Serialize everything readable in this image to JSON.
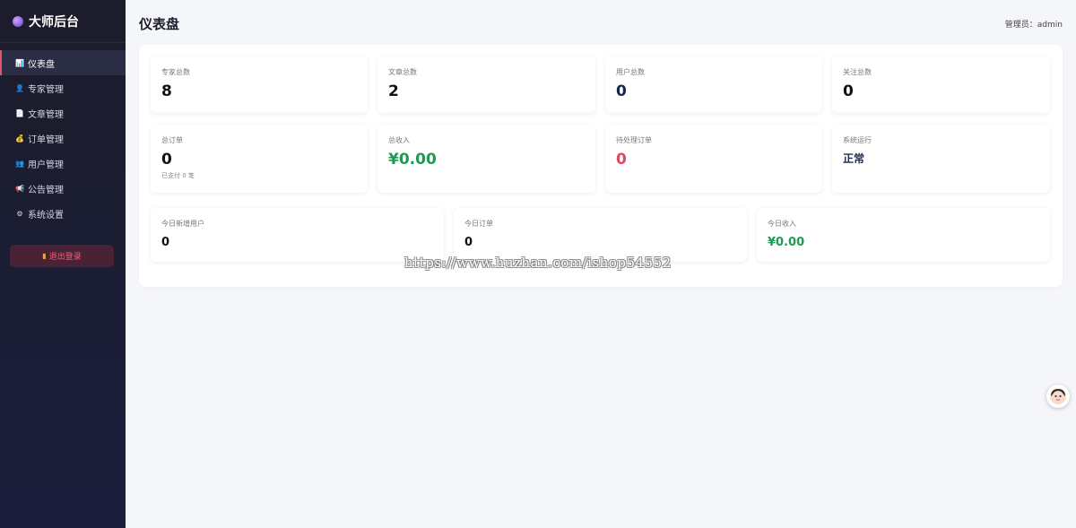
{
  "sidebar": {
    "brand": "大师后台",
    "items": [
      {
        "label": "仪表盘",
        "icon": "bar-chart-icon",
        "glyph": "📊",
        "active": true
      },
      {
        "label": "专家管理",
        "icon": "person-icon",
        "glyph": "👤",
        "active": false
      },
      {
        "label": "文章管理",
        "icon": "document-icon",
        "glyph": "📄",
        "active": false
      },
      {
        "label": "订单管理",
        "icon": "money-bag-icon",
        "glyph": "💰",
        "active": false
      },
      {
        "label": "用户管理",
        "icon": "users-icon",
        "glyph": "👥",
        "active": false
      },
      {
        "label": "公告管理",
        "icon": "megaphone-icon",
        "glyph": "📢",
        "active": false
      },
      {
        "label": "系统设置",
        "icon": "gear-icon",
        "glyph": "⚙",
        "active": false
      }
    ],
    "logout_label": "退出登录"
  },
  "header": {
    "title": "仪表盘",
    "admin_text": "管理员：admin"
  },
  "stats": {
    "experts": {
      "label": "专家总数",
      "value": "8"
    },
    "articles": {
      "label": "文章总数",
      "value": "2"
    },
    "users": {
      "label": "用户总数",
      "value": "0"
    },
    "follows": {
      "label": "关注总数",
      "value": "0"
    },
    "orders": {
      "label": "总订单",
      "value": "0",
      "sub": "已支付 0 笔"
    },
    "revenue": {
      "label": "总收入",
      "value": "¥0.00"
    },
    "pending": {
      "label": "待处理订单",
      "value": "0"
    },
    "system": {
      "label": "系统运行",
      "value": "正常"
    },
    "today_users": {
      "label": "今日新增用户",
      "value": "0"
    },
    "today_orders": {
      "label": "今日订单",
      "value": "0"
    },
    "today_revenue": {
      "label": "今日收入",
      "value": "¥0.00"
    }
  },
  "watermark": "https://www.huzhan.com/ishop54552",
  "colors": {
    "sidebar_bg": "#1c1c2b",
    "accent_active": "#e0556b",
    "money_green": "#1e9a55",
    "pending_red": "#e04a61"
  }
}
